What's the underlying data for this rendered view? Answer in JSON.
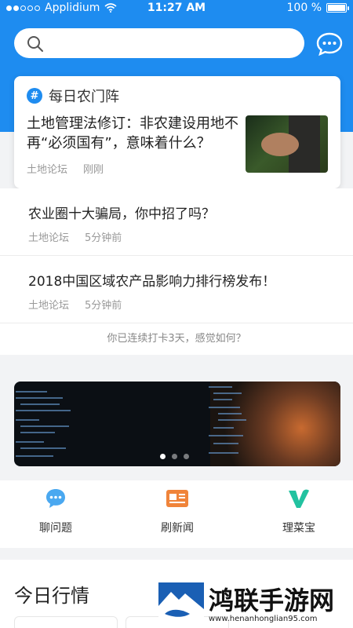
{
  "status_bar": {
    "carrier": "Applidium",
    "time": "11:27 AM",
    "battery": "100 %"
  },
  "search": {
    "placeholder": ""
  },
  "featured": {
    "tag": "每日农门阵",
    "title": "土地管理法修订：非农建设用地不再“必须国有”，意味着什么？",
    "source": "土地论坛",
    "time": "刚刚"
  },
  "articles": [
    {
      "title": "农业圈十大骗局，你中招了吗？",
      "source": "土地论坛",
      "time": "5分钟前"
    },
    {
      "title": "2018中国区域农产品影响力排行榜发布！",
      "source": "土地论坛",
      "time": "5分钟前"
    }
  ],
  "checkin": {
    "text": "你已连续打卡3天，感觉如何？"
  },
  "banner": {
    "pages": 3,
    "active_page": 1
  },
  "quick_actions": [
    {
      "label": "聊问题",
      "icon": "chat-bubble-icon"
    },
    {
      "label": "刷新闻",
      "icon": "newspaper-icon"
    },
    {
      "label": "理菜宝",
      "icon": "v-logo-icon"
    }
  ],
  "market": {
    "title": "今日行情"
  },
  "watermark": {
    "name": "鸿联手游网",
    "url": "www.henanhonglian95.com"
  },
  "colors": {
    "primary": "#1e8cf0",
    "orange": "#f0843a",
    "green": "#22c2a0"
  }
}
